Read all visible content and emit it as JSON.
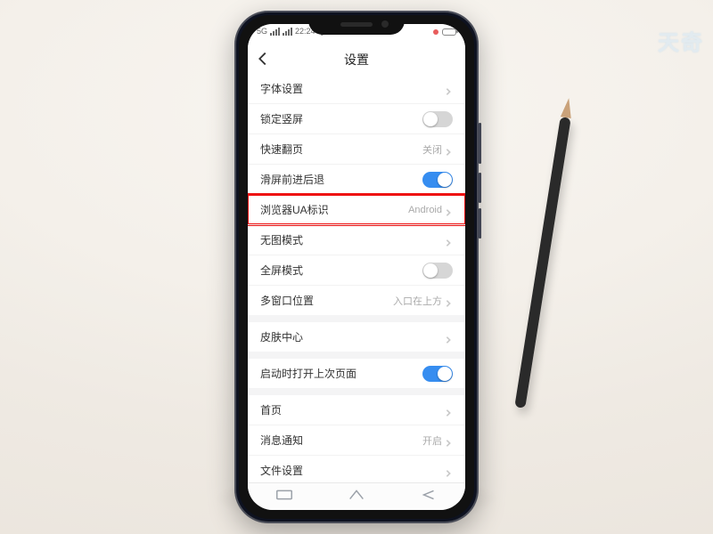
{
  "status": {
    "time": "22:24",
    "carrier_hint": "5G",
    "extra": "Q"
  },
  "header": {
    "title": "设置"
  },
  "watermark": "天奇",
  "groups": [
    {
      "rows": [
        {
          "id": "font",
          "label": "字体设置",
          "type": "link"
        },
        {
          "id": "lock",
          "label": "锁定竖屏",
          "type": "toggle",
          "on": false
        },
        {
          "id": "fastpage",
          "label": "快速翻页",
          "type": "value",
          "value": "关闭"
        },
        {
          "id": "swipe",
          "label": "滑屏前进后退",
          "type": "toggle",
          "on": true
        },
        {
          "id": "ua",
          "label": "浏览器UA标识",
          "type": "value",
          "value": "Android",
          "highlight": true
        },
        {
          "id": "noimg",
          "label": "无图模式",
          "type": "link"
        },
        {
          "id": "fullscreen",
          "label": "全屏模式",
          "type": "toggle",
          "on": false
        },
        {
          "id": "multiwin",
          "label": "多窗口位置",
          "type": "value",
          "value": "入口在上方"
        }
      ]
    },
    {
      "rows": [
        {
          "id": "skin",
          "label": "皮肤中心",
          "type": "link"
        }
      ]
    },
    {
      "rows": [
        {
          "id": "restore",
          "label": "启动时打开上次页面",
          "type": "toggle",
          "on": true
        }
      ]
    },
    {
      "rows": [
        {
          "id": "home",
          "label": "首页",
          "type": "link"
        },
        {
          "id": "notify",
          "label": "消息通知",
          "type": "value",
          "value": "开启"
        },
        {
          "id": "files",
          "label": "文件设置",
          "type": "link"
        }
      ]
    }
  ]
}
